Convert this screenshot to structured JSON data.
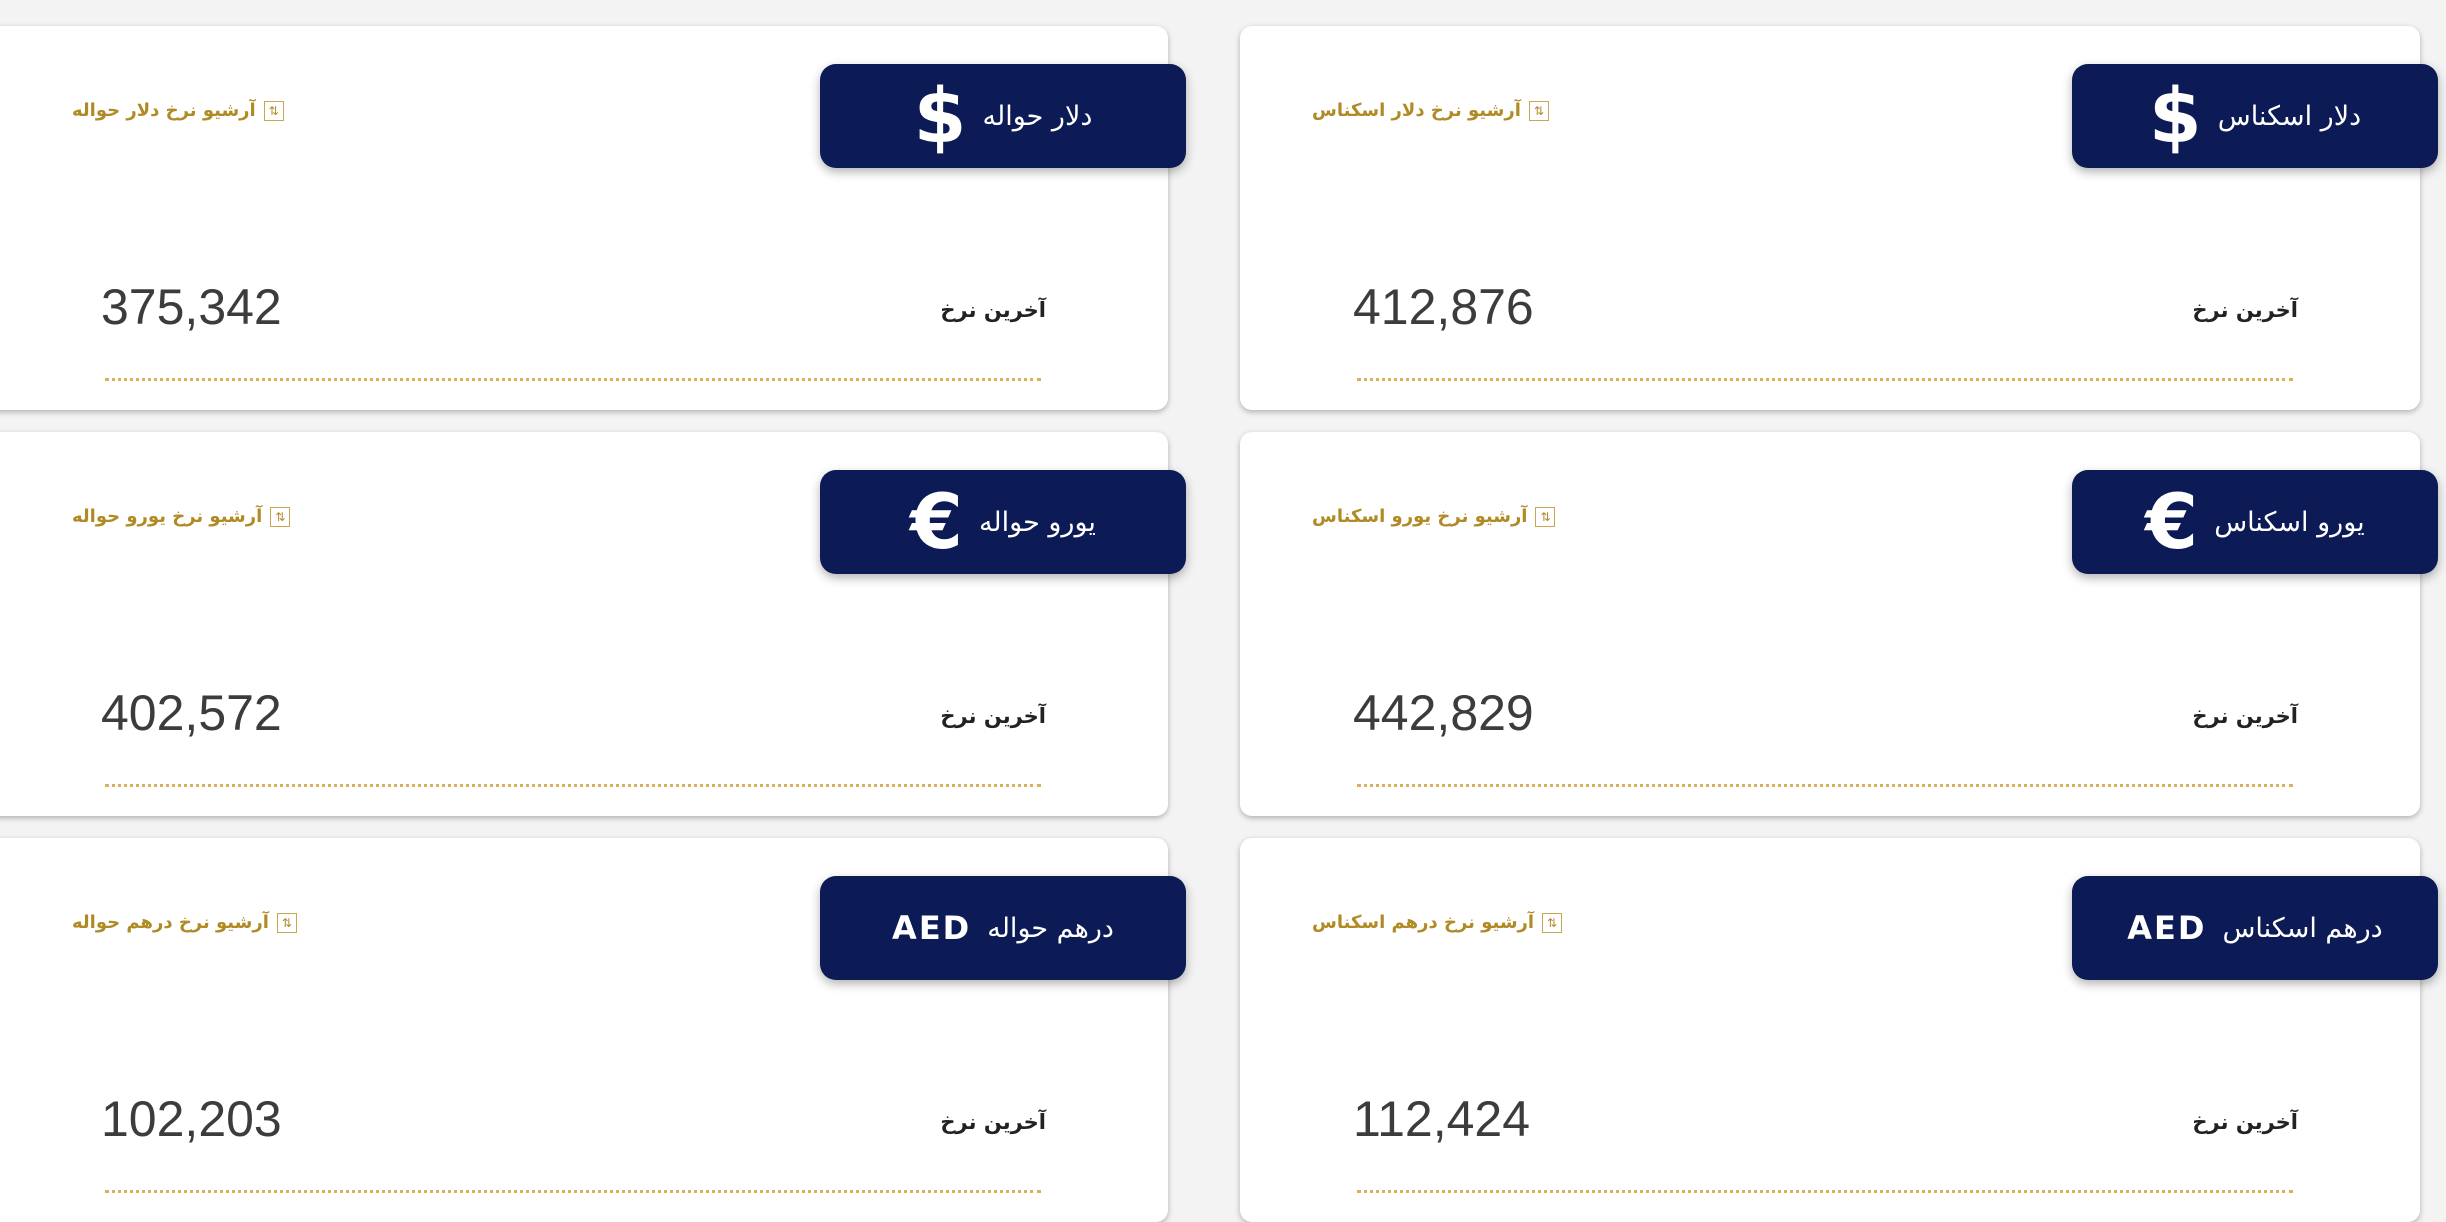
{
  "colors": {
    "background": "#f3f3f3",
    "badge": "#0c1a56",
    "archive_link": "#b08a24",
    "divider": "#d7b25a",
    "value_text": "#3c3c3c"
  },
  "cards": {
    "dollar_cash": {
      "icon": "dollar-sign-icon",
      "icon_text": "$",
      "title": "دلار اسکناس",
      "archive_label": "آرشیو نرخ دلار اسکناس",
      "rate_label": "آخرین نرخ",
      "rate_value": "412,876"
    },
    "dollar_transfer": {
      "icon": "dollar-sign-icon",
      "icon_text": "$",
      "title": "دلار حواله",
      "archive_label": "آرشیو نرخ دلار حواله",
      "rate_label": "آخرین نرخ",
      "rate_value": "375,342"
    },
    "euro_cash": {
      "icon": "euro-sign-icon",
      "icon_text": "€",
      "title": "یورو اسکناس",
      "archive_label": "آرشیو نرخ یورو اسکناس",
      "rate_label": "آخرین نرخ",
      "rate_value": "442,829"
    },
    "euro_transfer": {
      "icon": "euro-sign-icon",
      "icon_text": "€",
      "title": "یورو حواله",
      "archive_label": "آرشیو نرخ یورو حواله",
      "rate_label": "آخرین نرخ",
      "rate_value": "402,572"
    },
    "dirham_cash": {
      "icon": "aed-icon",
      "icon_text": "AED",
      "title": "درهم اسکناس",
      "archive_label": "آرشیو نرخ درهم اسکناس",
      "rate_label": "آخرین نرخ",
      "rate_value": "112,424"
    },
    "dirham_transfer": {
      "icon": "aed-icon",
      "icon_text": "AED",
      "title": "درهم حواله",
      "archive_label": "آرشیو نرخ درهم حواله",
      "rate_label": "آخرین نرخ",
      "rate_value": "102,203"
    }
  }
}
